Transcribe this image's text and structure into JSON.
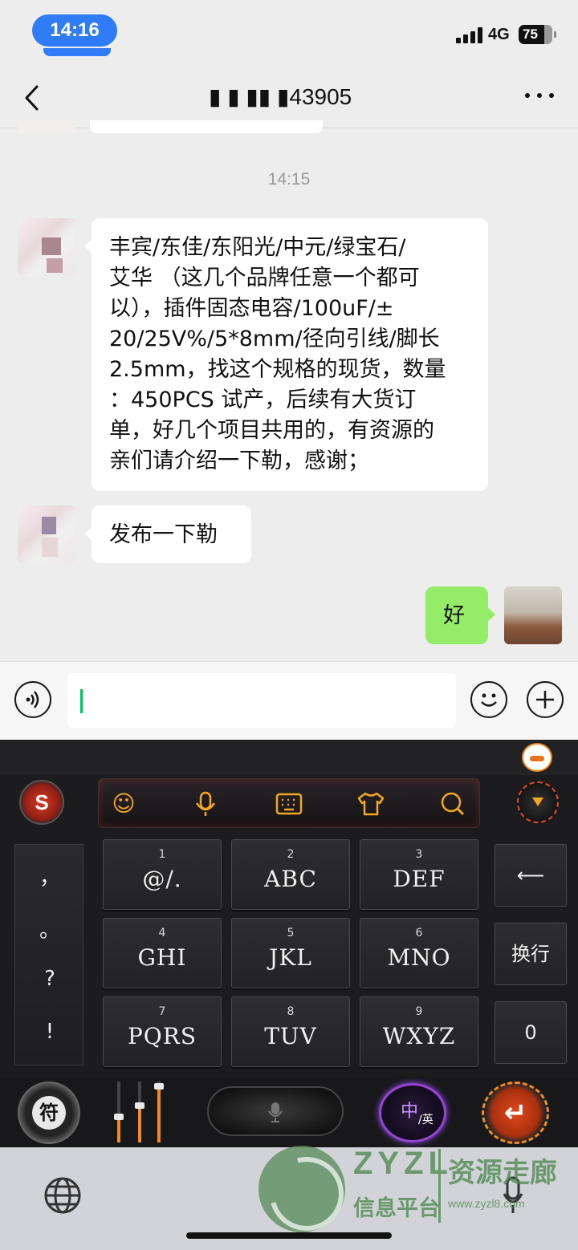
{
  "status_bar": {
    "time": "14:16",
    "network": "4G",
    "battery": "75"
  },
  "header": {
    "title": "▮ ▮ ▮▮ ▮43905"
  },
  "chat": {
    "timestamp": "14:15",
    "messages": [
      {
        "from": "other",
        "text_lines": [
          "丰宾/东佳/东阳光/中元/绿宝石/",
          "艾华 （这几个品牌任意一个都可",
          "以），插件固态电容/100uF/±",
          "20/25V%/5*8mm/径向引线/脚长",
          "2.5mm，找这个规格的现货，数量",
          "：450PCS 试产，后续有大货订",
          "单，好几个项目共用的，有资源的",
          "亲们请介绍一下勒，感谢；"
        ]
      },
      {
        "from": "other",
        "text": "发布一下勒"
      },
      {
        "from": "me",
        "text": "好"
      }
    ]
  },
  "input": {
    "value": ""
  },
  "keyboard": {
    "side_punct": [
      "，",
      "。",
      "?",
      "!"
    ],
    "keys": [
      {
        "num": "1",
        "letters": "@/."
      },
      {
        "num": "2",
        "letters": "ABC"
      },
      {
        "num": "3",
        "letters": "DEF"
      },
      {
        "num": "4",
        "letters": "GHI"
      },
      {
        "num": "5",
        "letters": "JKL"
      },
      {
        "num": "6",
        "letters": "MNO"
      },
      {
        "num": "7",
        "letters": "PQRS"
      },
      {
        "num": "8",
        "letters": "TUV"
      },
      {
        "num": "9",
        "letters": "WXYZ"
      }
    ],
    "backspace_label": "⟵",
    "newline_label": "换行",
    "zero_label": "0",
    "symbols_label": "符",
    "lang_zh": "中",
    "lang_en": "/英",
    "logo_label": "S"
  },
  "watermark": {
    "brand": "ZYZL",
    "cn": "资源走廊",
    "sub": "信息平台",
    "url": "www.zyzl8.com"
  },
  "colors": {
    "my_bubble": "#95ec69",
    "accent_orange": "#f08a24",
    "wechat_green": "#07c160"
  }
}
